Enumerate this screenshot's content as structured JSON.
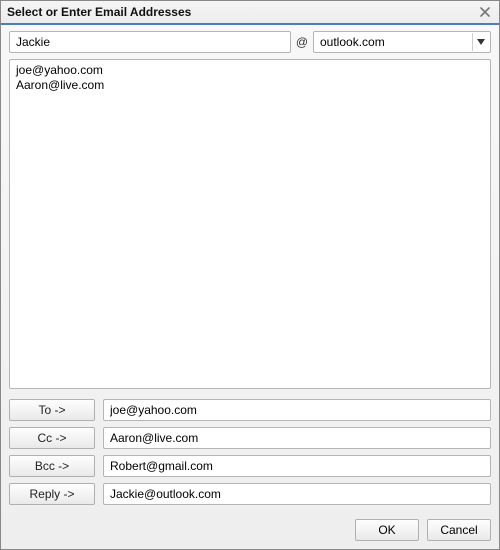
{
  "window": {
    "title": "Select or Enter Email Addresses"
  },
  "input": {
    "name_value": "Jackie",
    "at_symbol": "@",
    "domain_value": "outlook.com"
  },
  "list": {
    "items": [
      "joe@yahoo.com",
      "Aaron@live.com"
    ]
  },
  "fields": {
    "to": {
      "label": "To ->",
      "value": "joe@yahoo.com"
    },
    "cc": {
      "label": "Cc ->",
      "value": "Aaron@live.com"
    },
    "bcc": {
      "label": "Bcc ->",
      "value": "Robert@gmail.com"
    },
    "reply": {
      "label": "Reply ->",
      "value": "Jackie@outlook.com"
    }
  },
  "buttons": {
    "ok": "OK",
    "cancel": "Cancel"
  }
}
